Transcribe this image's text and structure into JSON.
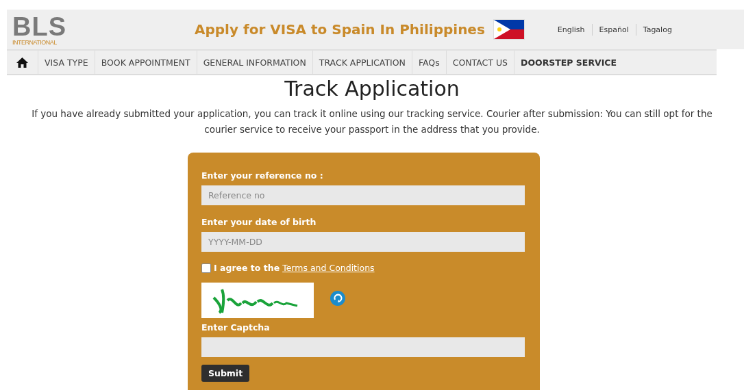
{
  "header": {
    "logo": {
      "text": "BLS",
      "subtext": "INTERNATIONAL"
    },
    "title": "Apply for VISA to Spain In Philippines",
    "languages": [
      "English",
      "Español",
      "Tagalog"
    ]
  },
  "nav": [
    {
      "label": "VISA TYPE",
      "highlighted": false
    },
    {
      "label": "BOOK APPOINTMENT",
      "highlighted": false
    },
    {
      "label": "GENERAL INFORMATION",
      "highlighted": false
    },
    {
      "label": "TRACK APPLICATION",
      "highlighted": false
    },
    {
      "label": "FAQs",
      "highlighted": false
    },
    {
      "label": "CONTACT US",
      "highlighted": false
    },
    {
      "label": "DOORSTEP SERVICE",
      "highlighted": true
    }
  ],
  "page_title": "Track Application",
  "intro": "If you have already submitted your application, you can track it online using our tracking service. Courier after submission: You can still opt for the courier service to receive your passport in the address that you provide.",
  "form": {
    "reference_label": "Enter your reference no :",
    "reference": {
      "placeholder": "Reference no"
    },
    "dob_label": "Enter your date of birth",
    "dob": {
      "placeholder": "YYYY-MM-DD"
    },
    "agree": {
      "checked": false,
      "text": "I agree to the",
      "link": "Terms and Conditions"
    },
    "captcha_label": "Enter Captcha",
    "submit": "Submit"
  }
}
